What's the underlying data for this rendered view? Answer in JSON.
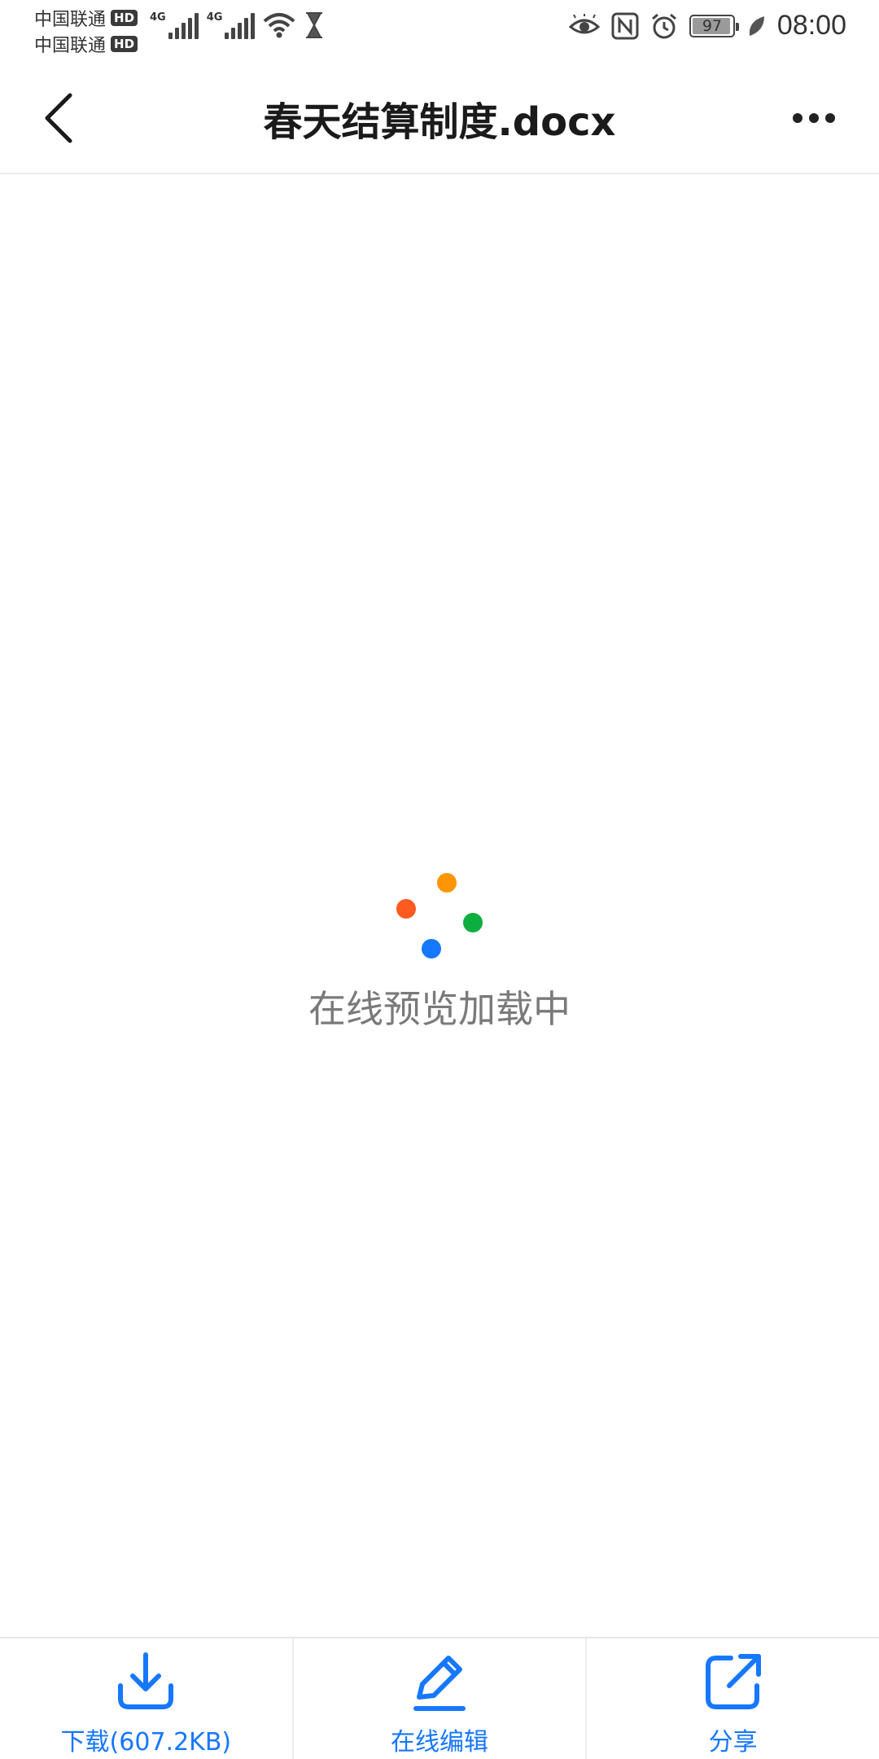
{
  "status_bar": {
    "carrier_1": "中国联通",
    "carrier_2": "中国联通",
    "hd_badge": "HD",
    "network_1": "4G",
    "network_2": "4G",
    "battery": "97",
    "time": "08:00"
  },
  "header": {
    "title": "春天结算制度.docx",
    "back_icon": "chevron-left-icon",
    "more_icon": "more-horizontal-icon"
  },
  "loading": {
    "text": "在线预览加载中",
    "dot_colors": [
      "#ff5a1f",
      "#ff9500",
      "#0bae3f",
      "#1677ff"
    ]
  },
  "bottom_bar": {
    "download_label": "下载(607.2KB)",
    "edit_label": "在线编辑",
    "share_label": "分享",
    "accent": "#1677ff"
  }
}
